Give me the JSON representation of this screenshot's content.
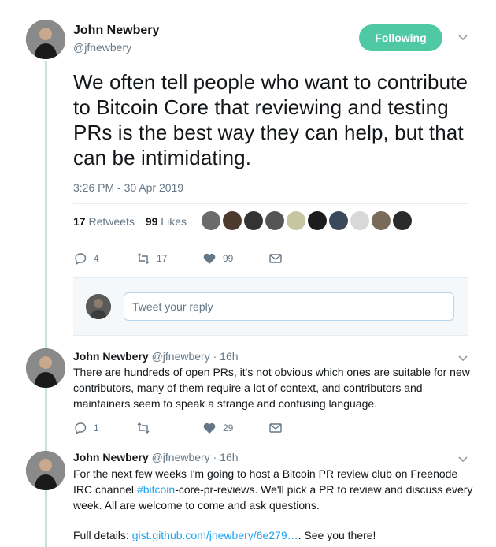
{
  "main_tweet": {
    "author_name": "John Newbery",
    "author_handle": "@jfnewbery",
    "follow_label": "Following",
    "text": "We often tell people who want to contribute to Bitcoin Core that reviewing and testing PRs is the best way they can help, but that can be intimidating.",
    "timestamp": "3:26 PM - 30 Apr 2019",
    "retweets_count": "17",
    "retweets_label": "Retweets",
    "likes_count": "99",
    "likes_label": "Likes",
    "reply_count": "4",
    "retweet_count": "17",
    "like_count": "99"
  },
  "reply_box": {
    "placeholder": "Tweet your reply"
  },
  "thread": [
    {
      "author_name": "John Newbery",
      "author_handle": "@jfnewbery",
      "time": "· 16h",
      "text": "There are hundreds of open PRs, it's not obvious which ones are suitable for new contributors, many of them require a lot of context, and contributors and maintainers seem to speak a strange and confusing language.",
      "reply_count": "1",
      "like_count": "29"
    },
    {
      "author_name": "John Newbery",
      "author_handle": "@jfnewbery",
      "time": "· 16h",
      "text_pre": "For the next few weeks I'm going to host a Bitcoin PR review club on Freenode IRC channel ",
      "hashtag": "#bitcoin",
      "text_post": "-core-pr-reviews. We'll pick a PR to review and discuss every week. All are welcome to come and ask questions.",
      "details_label": "Full details: ",
      "link": "gist.github.com/jnewbery/6e279…",
      "details_end": ". See you there!"
    }
  ],
  "colors": {
    "accent": "#4ec9a4",
    "link": "#1da1f2",
    "thread_line": "#c4e3e0",
    "like_heart": "#657786"
  }
}
